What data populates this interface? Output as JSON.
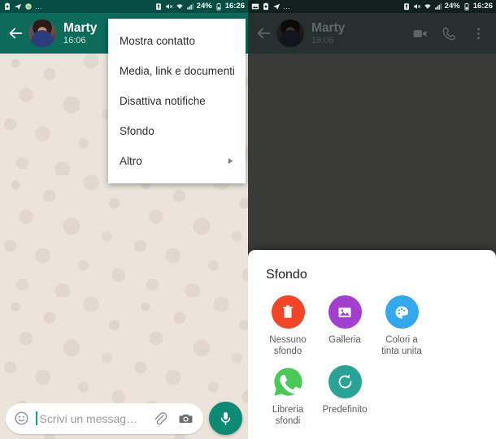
{
  "statusbar": {
    "left_icons_panel1": [
      "notification-icon",
      "telegram-icon",
      "app-icon",
      "more-dots-icon"
    ],
    "left_icons_panel2": [
      "image-icon",
      "notification-icon",
      "telegram-icon",
      "more-dots-icon"
    ],
    "dots": "…",
    "right_icons": [
      "sim-icon",
      "mute-icon",
      "wifi-icon",
      "signal-icon"
    ],
    "battery_percent": "24%",
    "time": "16:26"
  },
  "appbar": {
    "contact_name": "Marty",
    "contact_time": "16:06",
    "back_icon": "back-arrow-icon",
    "avatar": "contact-avatar",
    "actions": [
      "video-call-icon",
      "voice-call-icon",
      "overflow-menu-icon"
    ]
  },
  "menu": {
    "items": [
      {
        "label": "Mostra contatto",
        "submenu": false
      },
      {
        "label": "Media, link e documenti",
        "submenu": false
      },
      {
        "label": "Disattiva notifiche",
        "submenu": false
      },
      {
        "label": "Sfondo",
        "submenu": false
      },
      {
        "label": "Altro",
        "submenu": true
      }
    ]
  },
  "composer": {
    "emoji_icon": "emoji-icon",
    "placeholder": "Scrivi un messag…",
    "attach_icon": "paperclip-icon",
    "camera_icon": "camera-icon",
    "mic_icon": "microphone-icon"
  },
  "sheet": {
    "title": "Sfondo",
    "options": [
      {
        "label": "Nessuno\nsfondo",
        "icon": "trash-icon",
        "color": "#f04526"
      },
      {
        "label": "Galleria",
        "icon": "gallery-icon",
        "color": "#a23fd0"
      },
      {
        "label": "Colori a\ntinta unita",
        "icon": "palette-icon",
        "color": "#34a8ec"
      },
      {
        "label": "Libreria\nsfondi",
        "icon": "whatsapp-icon",
        "color": "#4ac959"
      },
      {
        "label": "Predefinito",
        "icon": "restore-icon",
        "color": "#2aa397"
      }
    ]
  },
  "colors": {
    "header_green": "#0c6b5b",
    "status_green": "#054c42",
    "chat_beige": "#ece4db",
    "dim_header": "#26302e",
    "dim_chat": "#3a3a38",
    "mic_green": "#0e8a74"
  }
}
